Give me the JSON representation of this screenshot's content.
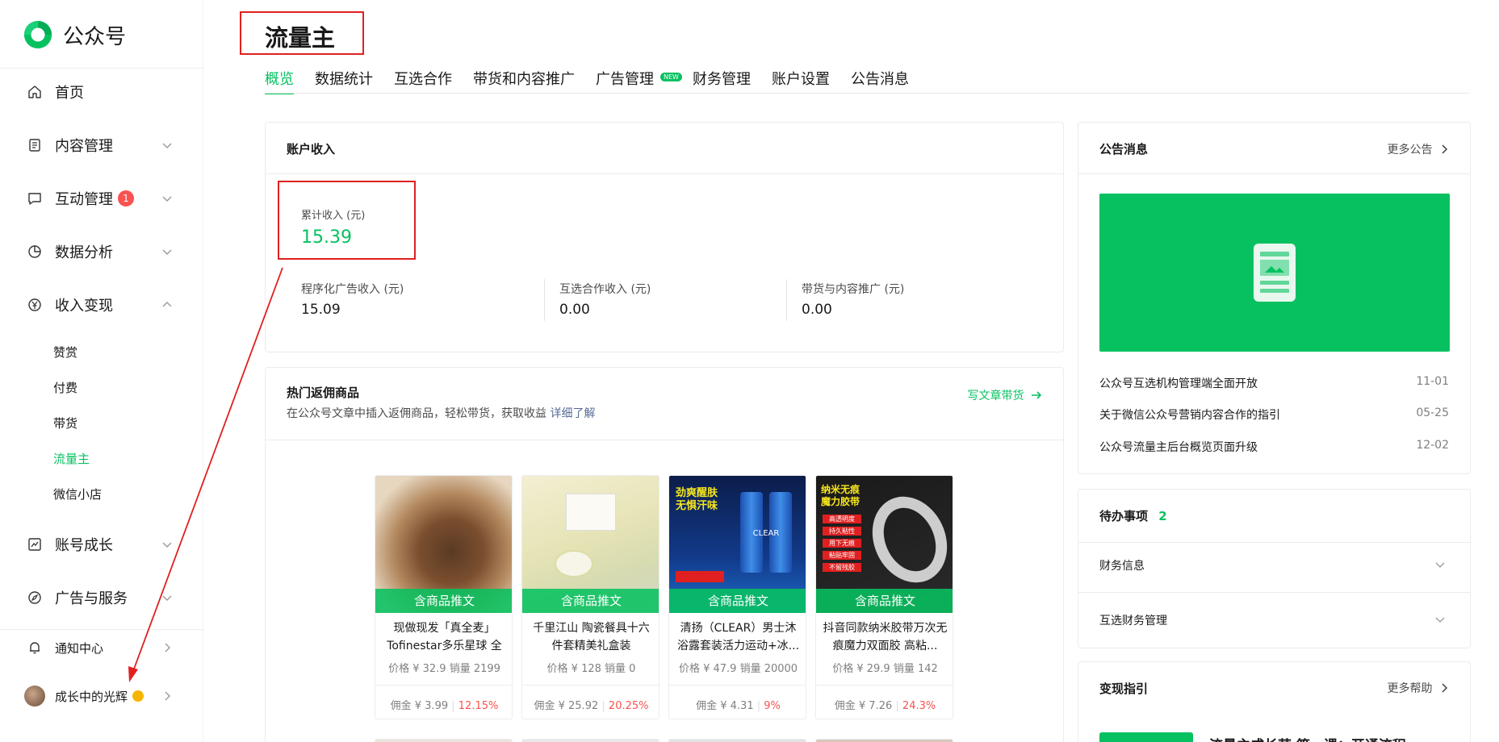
{
  "app": {
    "name": "公众号"
  },
  "sidebar": {
    "items": [
      {
        "label": "首页",
        "icon": "home-icon"
      },
      {
        "label": "内容管理",
        "icon": "document-icon"
      },
      {
        "label": "互动管理",
        "icon": "chat-icon",
        "badge": "1"
      },
      {
        "label": "数据分析",
        "icon": "pie-chart-icon"
      },
      {
        "label": "收入变现",
        "icon": "yuan-icon"
      },
      {
        "label": "账号成长",
        "icon": "growth-chart-icon"
      },
      {
        "label": "广告与服务",
        "icon": "compass-icon"
      },
      {
        "label": "通知中心",
        "icon": "bell-icon"
      }
    ],
    "subitems": [
      "赞赏",
      "付费",
      "带货",
      "流量主",
      "微信小店"
    ],
    "active_subitem": "流量主",
    "user": {
      "name": "成长中的光辉"
    }
  },
  "header": {
    "title": "流量主",
    "tabs": [
      "概览",
      "数据统计",
      "互选合作",
      "带货和内容推广",
      "广告管理",
      "财务管理",
      "账户设置",
      "公告消息"
    ],
    "new_tag": "NEW",
    "active_tab": "概览"
  },
  "income": {
    "title": "账户收入",
    "total_label": "累计收入 (元)",
    "total_value": "15.39",
    "breakdown": [
      {
        "label": "程序化广告收入 (元)",
        "value": "15.09"
      },
      {
        "label": "互选合作收入 (元)",
        "value": "0.00"
      },
      {
        "label": "带货与内容推广 (元)",
        "value": "0.00"
      }
    ]
  },
  "hot": {
    "title": "热门返佣商品",
    "desc": "在公众号文章中插入返佣商品，轻松带货，获取收益",
    "desc_link": "详细了解",
    "action": "写文章带货",
    "ribbon": "含商品推文",
    "products": [
      {
        "name": "现做现发「真全麦」Tofinestar多乐星球 全麦...",
        "price": "价格 ¥ 32.9",
        "sales": "销量 2199",
        "commission": "佣金 ¥ 3.99",
        "rate": "12.15%"
      },
      {
        "name": "千里江山 陶瓷餐具十六件套精美礼盒装",
        "price": "价格 ¥ 128",
        "sales": "销量 0",
        "commission": "佣金 ¥ 25.92",
        "rate": "20.25%"
      },
      {
        "name": "清扬（CLEAR）男士沐浴露套装活力运动+冰...",
        "price": "价格 ¥ 47.9",
        "sales": "销量 20000",
        "commission": "佣金 ¥ 4.31",
        "rate": "9%"
      },
      {
        "name": "抖音同款纳米胶带万次无痕魔力双面胶 高粘...",
        "price": "价格 ¥ 29.9",
        "sales": "销量 142",
        "commission": "佣金 ¥ 7.26",
        "rate": "24.3%"
      }
    ],
    "product_image_text": {
      "clear_title": "劲爽醒肤 无惧汗味",
      "clear_brand": "CLEAR",
      "tape_title": "纳米无痕 魔力胶带",
      "tape_tags": [
        "高透明度",
        "持久粘性",
        "用下无痕",
        "粘贴牢固",
        "不留残胶"
      ]
    }
  },
  "notices": {
    "title": "公告消息",
    "more": "更多公告",
    "items": [
      {
        "text": "公众号互选机构管理端全面开放",
        "date": "11-01"
      },
      {
        "text": "关于微信公众号营销内容合作的指引",
        "date": "05-25"
      },
      {
        "text": "公众号流量主后台概览页面升级",
        "date": "12-02"
      }
    ]
  },
  "todo": {
    "title": "待办事项",
    "count": "2",
    "items": [
      "财务信息",
      "互选财务管理"
    ]
  },
  "guide": {
    "title": "变现指引",
    "more": "更多帮助",
    "item": "流量主成长营 第一课：开通流程"
  },
  "colors": {
    "accent": "#07c160",
    "danger": "#fa5151",
    "link": "#576b95",
    "annotation": "#e02020"
  }
}
